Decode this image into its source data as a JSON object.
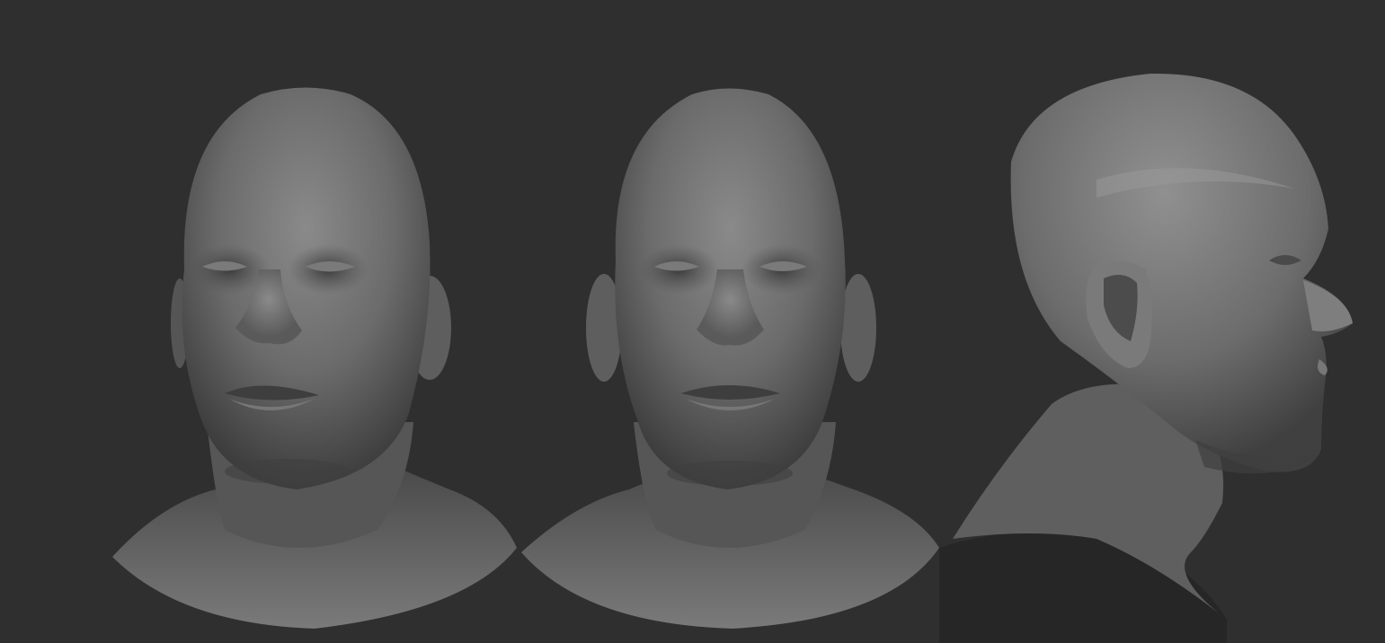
{
  "scene": {
    "background_color": "#2f2f2f",
    "material_base": "#6a6a6a",
    "material_highlight": "#8c8c8c",
    "material_shadow": "#2a2a2a",
    "views": [
      {
        "view": "front-three-quarter",
        "facing": "left"
      },
      {
        "view": "front",
        "facing": "forward"
      },
      {
        "view": "side-profile",
        "facing": "right"
      }
    ]
  }
}
